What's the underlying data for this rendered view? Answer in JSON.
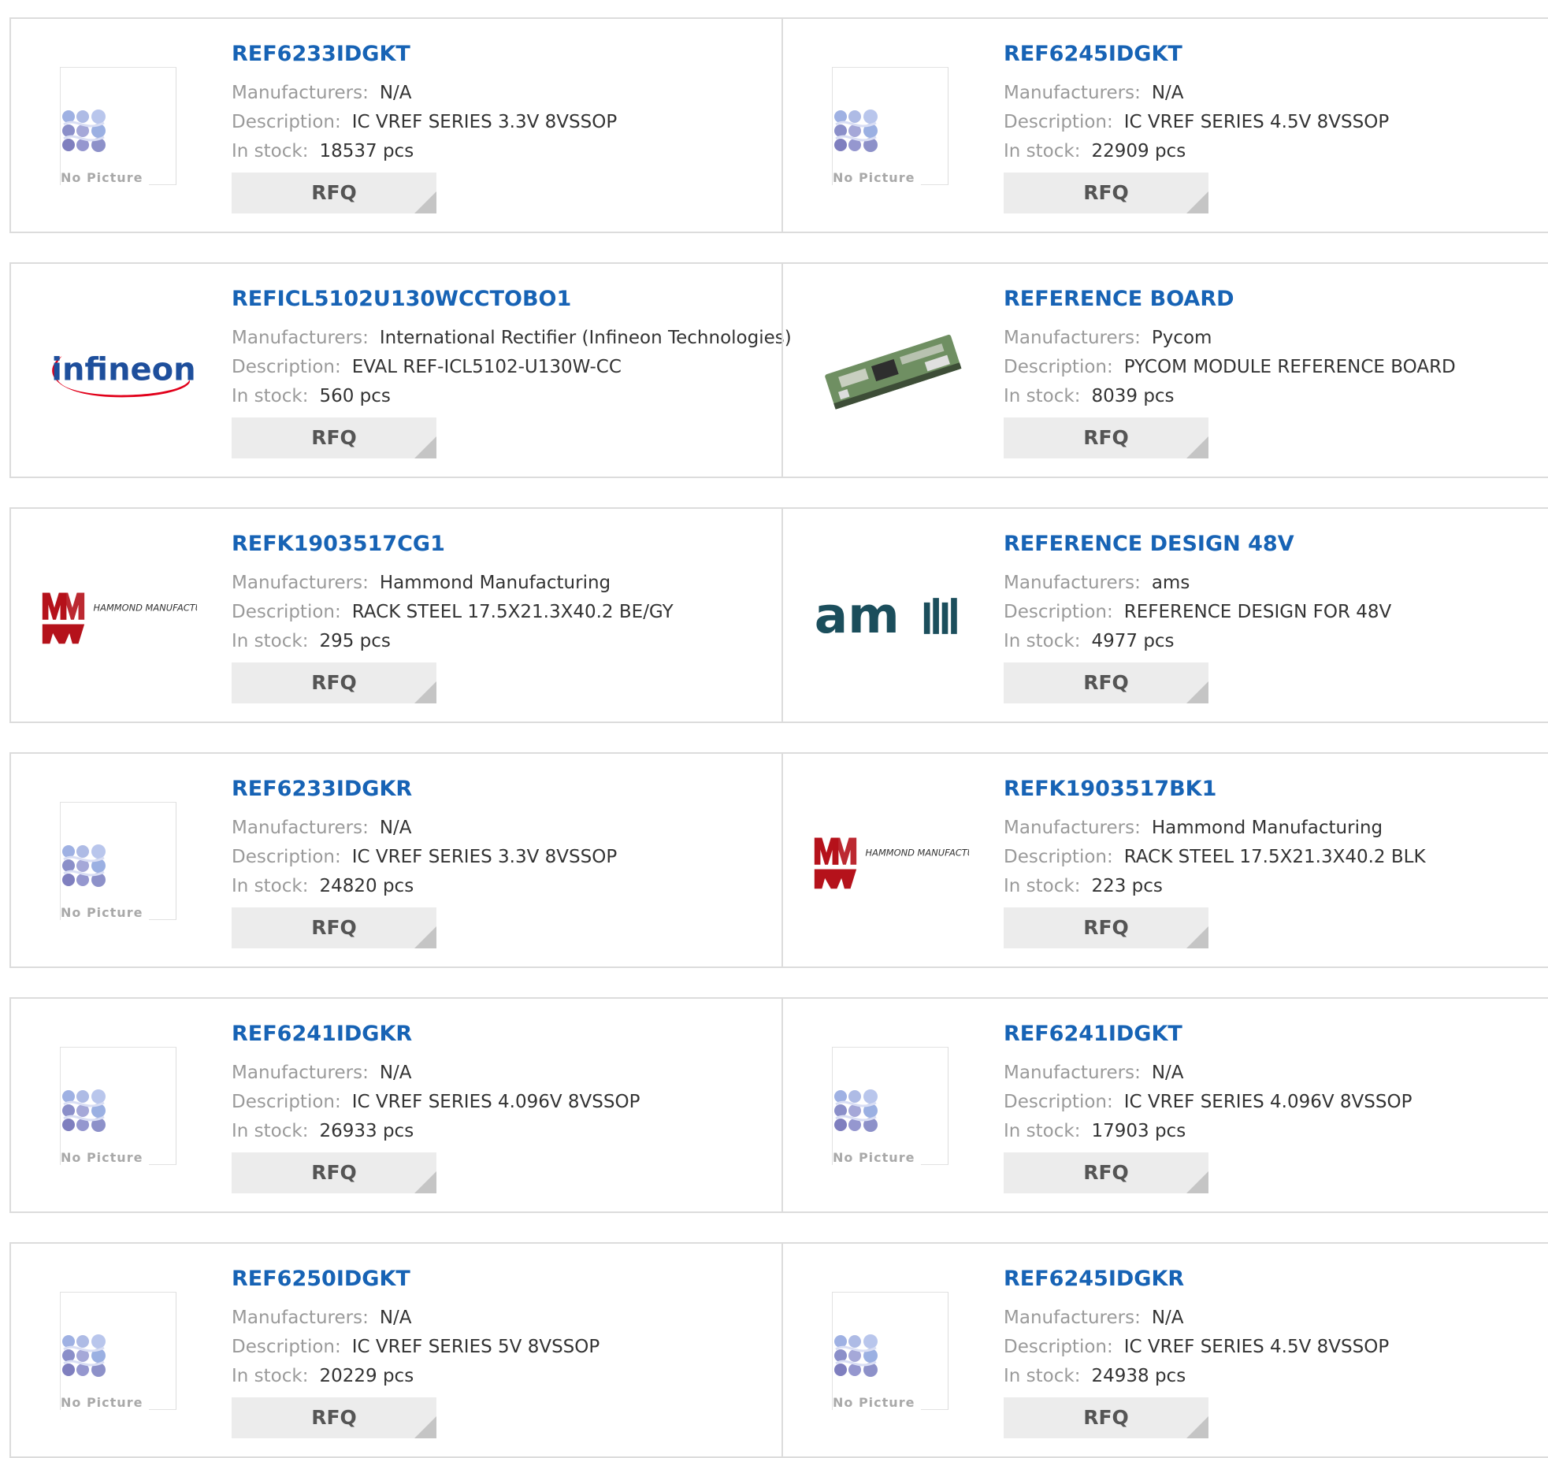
{
  "labels": {
    "manufacturers": "Manufacturers:",
    "description": "Description:",
    "in_stock": "In stock:",
    "rfq": "RFQ",
    "no_picture": "No Picture"
  },
  "products": [
    {
      "part": "REF6233IDGKT",
      "manufacturer": "N/A",
      "description": "IC VREF SERIES 3.3V 8VSSOP",
      "stock": "18537 pcs",
      "image": "no-picture"
    },
    {
      "part": "REF6245IDGKT",
      "manufacturer": "N/A",
      "description": "IC VREF SERIES 4.5V 8VSSOP",
      "stock": "22909 pcs",
      "image": "no-picture"
    },
    {
      "part": "REFICL5102U130WCCTOBO1",
      "manufacturer": "International Rectifier (Infineon Technologies)",
      "description": "EVAL REF-ICL5102-U130W-CC",
      "stock": "560 pcs",
      "image": "infineon-logo",
      "logo_text": "infineon"
    },
    {
      "part": "REFERENCE BOARD",
      "manufacturer": "Pycom",
      "description": "PYCOM MODULE REFERENCE BOARD",
      "stock": "8039 pcs",
      "image": "circuit-board-photo"
    },
    {
      "part": "REFK1903517CG1",
      "manufacturer": "Hammond Manufacturing",
      "description": "RACK STEEL 17.5X21.3X40.2 BE/GY",
      "stock": "295 pcs",
      "image": "hammond-logo",
      "logo_text": "HAMMOND MANUFACTURING."
    },
    {
      "part": "REFERENCE DESIGN 48V",
      "manufacturer": "ams",
      "description": "REFERENCE DESIGN FOR 48V",
      "stock": "4977 pcs",
      "image": "ams-logo",
      "logo_text": "am"
    },
    {
      "part": "REF6233IDGKR",
      "manufacturer": "N/A",
      "description": "IC VREF SERIES 3.3V 8VSSOP",
      "stock": "24820 pcs",
      "image": "no-picture"
    },
    {
      "part": "REFK1903517BK1",
      "manufacturer": "Hammond Manufacturing",
      "description": "RACK STEEL 17.5X21.3X40.2 BLK",
      "stock": "223 pcs",
      "image": "hammond-logo",
      "logo_text": "HAMMOND MANUFACTURING."
    },
    {
      "part": "REF6241IDGKR",
      "manufacturer": "N/A",
      "description": "IC VREF SERIES 4.096V 8VSSOP",
      "stock": "26933 pcs",
      "image": "no-picture"
    },
    {
      "part": "REF6241IDGKT",
      "manufacturer": "N/A",
      "description": "IC VREF SERIES 4.096V 8VSSOP",
      "stock": "17903 pcs",
      "image": "no-picture"
    },
    {
      "part": "REF6250IDGKT",
      "manufacturer": "N/A",
      "description": "IC VREF SERIES 5V 8VSSOP",
      "stock": "20229 pcs",
      "image": "no-picture"
    },
    {
      "part": "REF6245IDGKR",
      "manufacturer": "N/A",
      "description": "IC VREF SERIES 4.5V 8VSSOP",
      "stock": "24938 pcs",
      "image": "no-picture"
    }
  ],
  "colors": {
    "title": "#1763b5",
    "label": "#9a9a9a",
    "value": "#333333",
    "border": "#dcdcdc",
    "rfq_bg": "#ececec",
    "infineon_blue": "#1e4f9c",
    "infineon_red": "#e1001a",
    "hammond_red": "#b5121b",
    "ams_teal": "#1b4e5c"
  }
}
